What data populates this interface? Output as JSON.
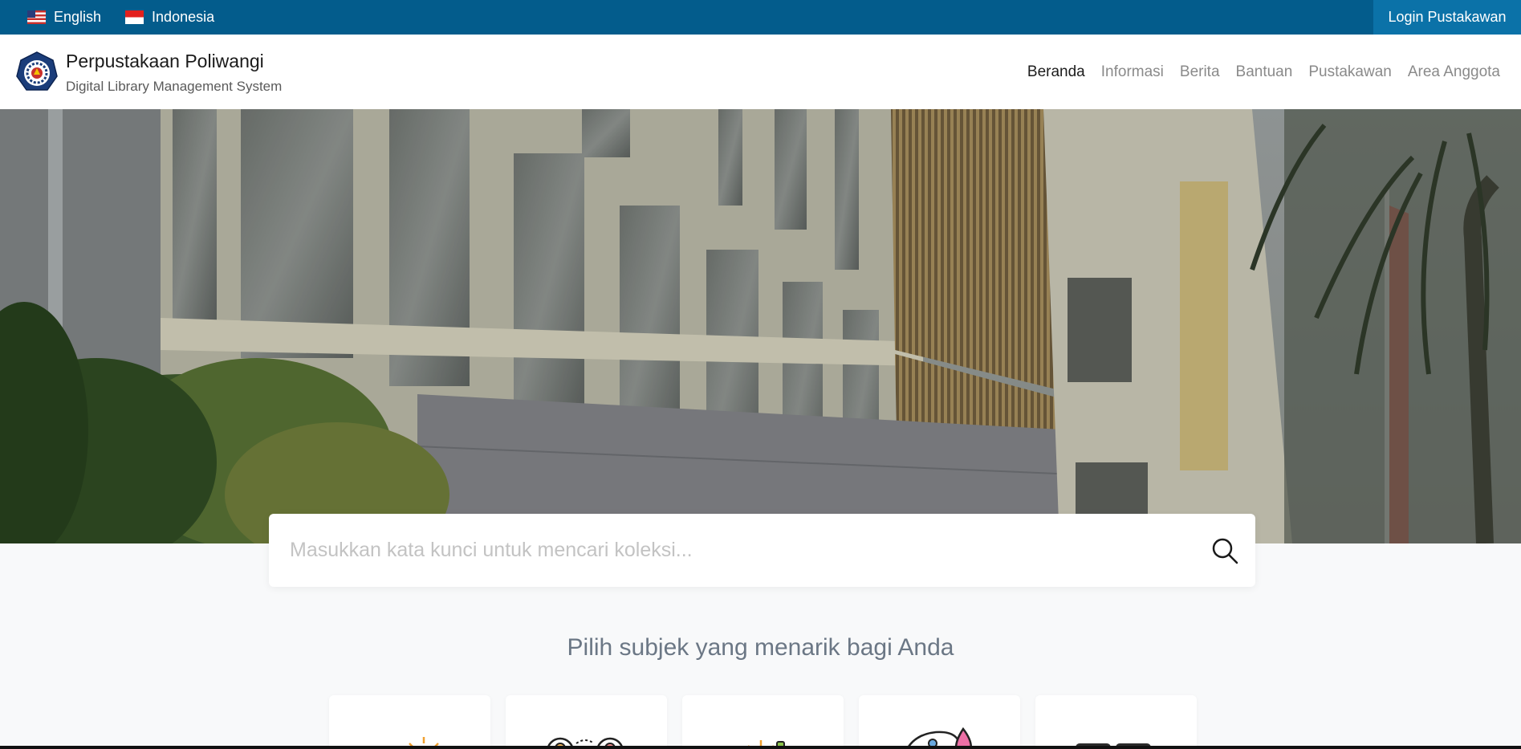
{
  "topbar": {
    "languages": [
      {
        "label": "English",
        "icon": "us-flag-icon"
      },
      {
        "label": "Indonesia",
        "icon": "indonesia-flag-icon"
      }
    ],
    "login_label": "Login Pustakawan"
  },
  "header": {
    "logo_icon": "poliwangi-logo-icon",
    "title": "Perpustakaan Poliwangi",
    "subtitle": "Digital Library Management System"
  },
  "nav": {
    "items": [
      {
        "label": "Beranda",
        "active": true
      },
      {
        "label": "Informasi"
      },
      {
        "label": "Berita"
      },
      {
        "label": "Bantuan"
      },
      {
        "label": "Pustakawan"
      },
      {
        "label": "Area Anggota"
      }
    ]
  },
  "search": {
    "value": "",
    "placeholder": "Masukkan kata kunci untuk mencari koleksi...",
    "icon": "search-icon"
  },
  "subjects": {
    "heading": "Pilih subjek yang menarik bagi Anda",
    "cards": [
      {
        "icon": "person-idea-icon"
      },
      {
        "icon": "people-exchange-icon"
      },
      {
        "icon": "lightbulb-tools-icon"
      },
      {
        "icon": "art-palette-icon"
      },
      {
        "icon": "grid-blocks-icon"
      }
    ]
  },
  "colors": {
    "topbar": "#035c8c",
    "login_button": "#0b72a8",
    "page_background": "#f8f9fa"
  }
}
